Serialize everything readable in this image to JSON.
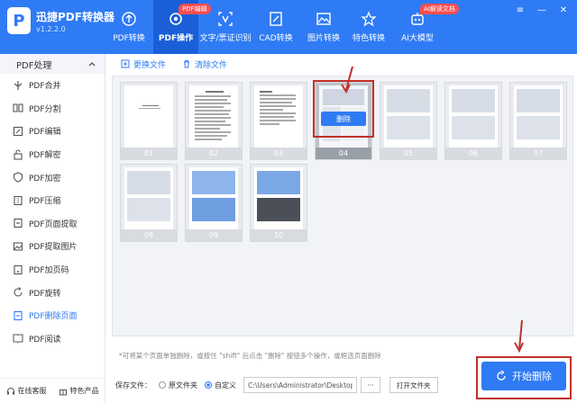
{
  "app": {
    "logo_letter": "P",
    "title": "迅捷PDF转换器",
    "version": "v1.2.2.0"
  },
  "nav": {
    "tabs": [
      {
        "label": "PDF转换",
        "icon": "convert-icon"
      },
      {
        "label": "PDF操作",
        "icon": "gear-icon",
        "active": true
      },
      {
        "label": "文字/票证识别",
        "icon": "ocr-icon"
      },
      {
        "label": "CAD转换",
        "icon": "cad-icon"
      },
      {
        "label": "图片转换",
        "icon": "image-icon"
      },
      {
        "label": "特色转换",
        "icon": "star-icon"
      },
      {
        "label": "AI大模型",
        "icon": "robot-icon"
      }
    ],
    "badge_edit": "PDF编辑",
    "badge_ai": "AI解读文档"
  },
  "window_controls": [
    "≡",
    "—",
    "✕"
  ],
  "sidebar": {
    "section": "PDF处理",
    "items": [
      "PDF合并",
      "PDF分割",
      "PDF编辑",
      "PDF解密",
      "PDF加密",
      "PDF压缩",
      "PDF页面提取",
      "PDF提取图片",
      "PDF加页码",
      "PDF旋转",
      "PDF删除页面",
      "PDF阅读"
    ],
    "active_index": 10,
    "footer": {
      "service": "在线客服",
      "products": "特色产品"
    }
  },
  "toolbar": {
    "replace": "更换文件",
    "clear": "清除文件"
  },
  "pages": [
    "01",
    "02",
    "03",
    "04",
    "05",
    "06",
    "07",
    "08",
    "09",
    "10"
  ],
  "selected_page": "04",
  "delete_label": "删除",
  "hint": "*可将某个页面单独删除，或按住 \"shift\" 后点击 \"删除\" 按钮多个操作，或框选页面删除",
  "save": {
    "label": "保存文件：",
    "option_source": "原文件夹",
    "option_custom": "自定义",
    "path": "C:\\Users\\Administrator\\Desktop",
    "browse": "···",
    "open_folder": "打开文件夹"
  },
  "start_button": "开始删除",
  "colors": {
    "brand": "#2f7bf5",
    "annotation": "#c0312b"
  }
}
